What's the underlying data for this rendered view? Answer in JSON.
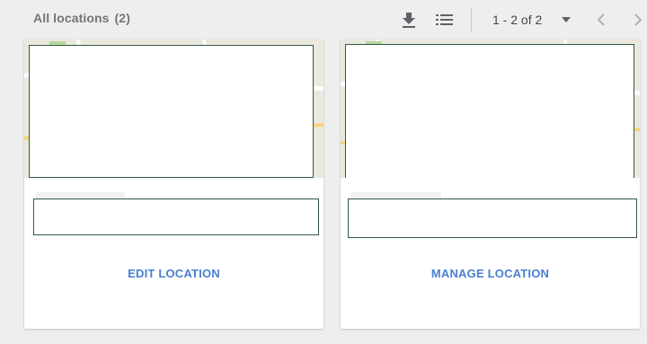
{
  "header": {
    "title": "All locations",
    "count": "(2)",
    "pagination_label": "1 - 2 of 2"
  },
  "icons": {
    "download": "download-icon",
    "list": "list-view-icon",
    "page_size": "dropdown-arrow-icon",
    "prev": "chevron-left-icon",
    "next": "chevron-right-icon"
  },
  "cards": [
    {
      "action_label": "EDIT LOCATION"
    },
    {
      "action_label": "MANAGE LOCATION"
    }
  ],
  "colors": {
    "background": "#eeeeee",
    "card": "#ffffff",
    "action_text": "#4a7fd1",
    "overlay_border": "#2f5a45",
    "header_text": "#757575"
  }
}
